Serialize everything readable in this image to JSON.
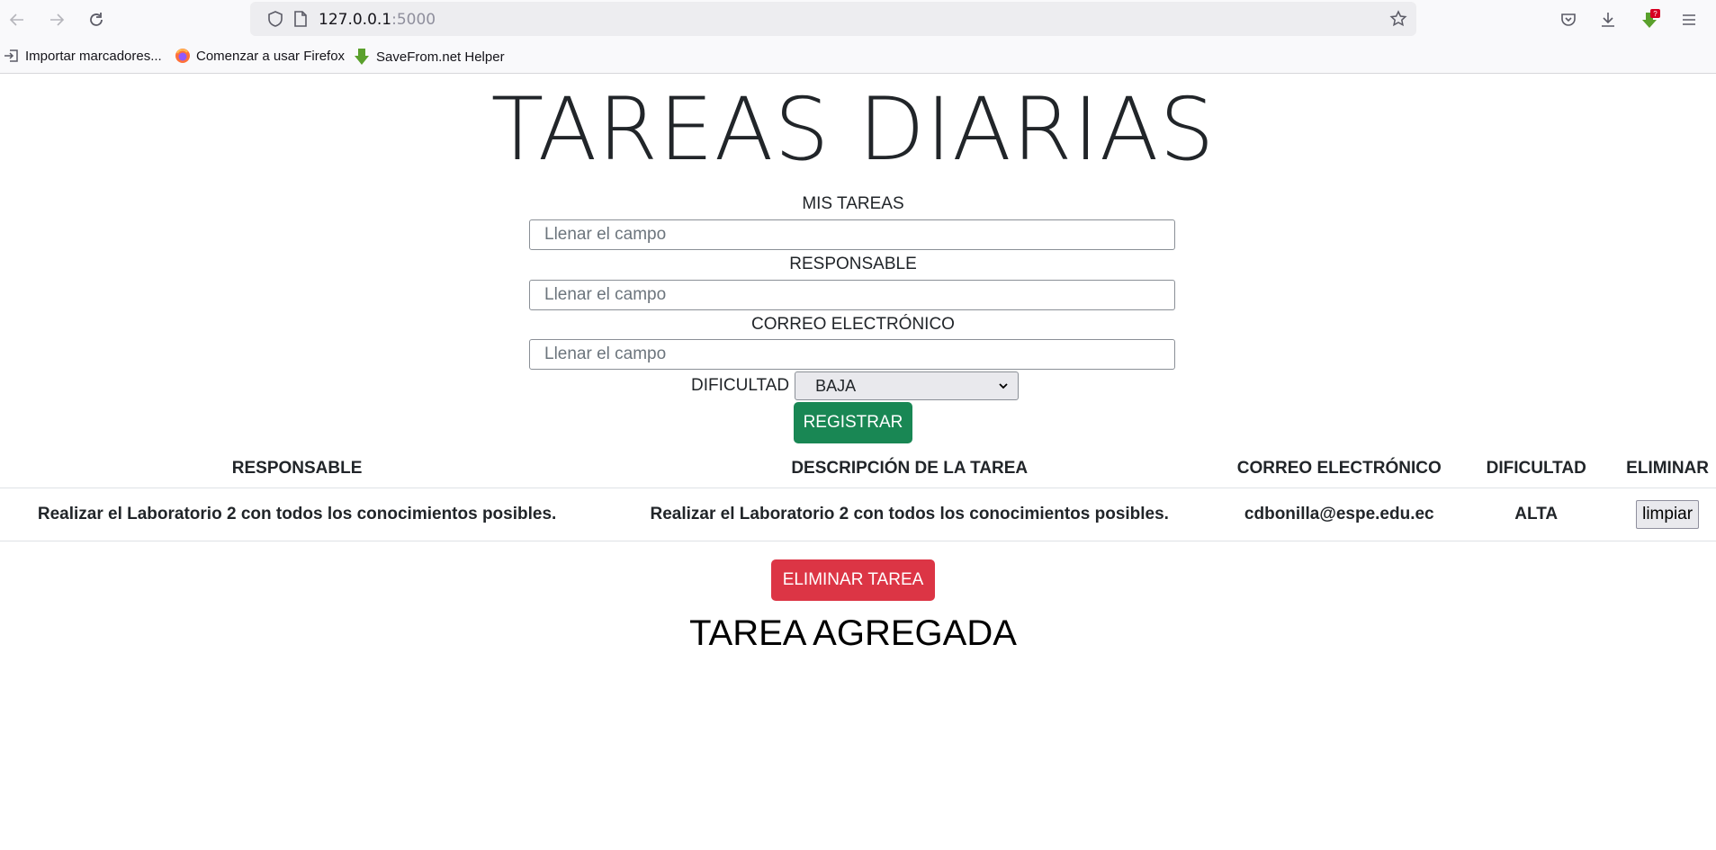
{
  "browser": {
    "url_host": "127.0.0.1",
    "url_port": ":5000",
    "download_badge": "?",
    "bookmarks": [
      {
        "label": "Importar marcadores...",
        "icon": "import-icon"
      },
      {
        "label": "Comenzar a usar Firefox",
        "icon": "firefox-icon"
      },
      {
        "label": "SaveFrom.net Helper",
        "icon": "download-arrow-icon"
      }
    ]
  },
  "page": {
    "title": "TAREAS DIARIAS",
    "form": {
      "tareas_label": "MIS TAREAS",
      "tareas_placeholder": "Llenar el campo",
      "responsable_label": "RESPONSABLE",
      "responsable_placeholder": "Llenar el campo",
      "correo_label": "CORREO ELECTRÓNICO",
      "correo_placeholder": "Llenar el campo",
      "dificultad_label": "DIFICULTAD",
      "dificultad_selected": "BAJA",
      "register_label": "REGISTRAR"
    },
    "table": {
      "headers": [
        "RESPONSABLE",
        "DESCRIPCIÓN DE LA TAREA",
        "CORREO ELECTRÓNICO",
        "DIFICULTAD",
        "ELIMINAR"
      ],
      "rows": [
        {
          "responsable": "Realizar el Laboratorio 2 con todos los conocimientos posibles.",
          "descripcion": "Realizar el Laboratorio 2 con todos los conocimientos posibles.",
          "correo": "cdbonilla@espe.edu.ec",
          "dificultad": "ALTA",
          "action": "limpiar"
        }
      ]
    },
    "delete_label": "ELIMINAR TAREA",
    "status_message": "TAREA AGREGADA"
  },
  "colors": {
    "success": "#198754",
    "danger": "#dc3545"
  }
}
